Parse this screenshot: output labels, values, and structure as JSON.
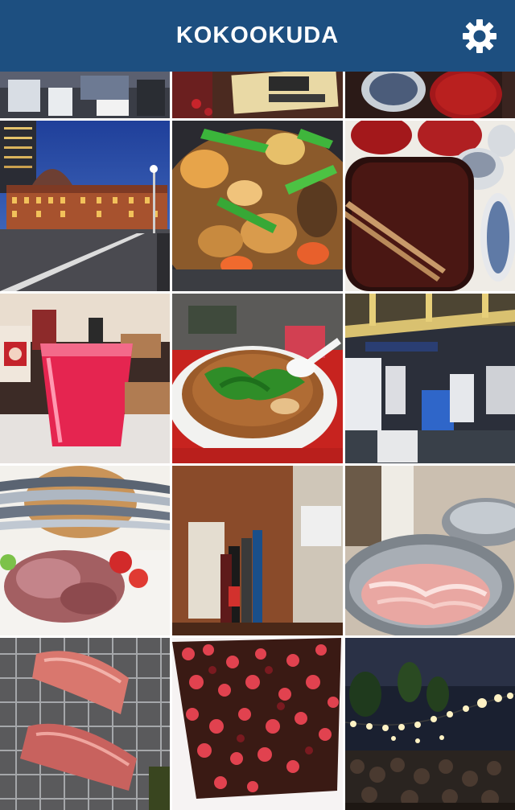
{
  "header": {
    "title": "KOKOOKUDA",
    "background": "#1d4f80",
    "settings_icon": "gear-icon"
  },
  "photos": [
    {
      "subject": "market-stalls"
    },
    {
      "subject": "chicken-sign"
    },
    {
      "subject": "tableware"
    },
    {
      "subject": "tokyo-station-night"
    },
    {
      "subject": "simmered-vegetables"
    },
    {
      "subject": "lacquer-tray-chopsticks"
    },
    {
      "subject": "red-drink"
    },
    {
      "subject": "ramen-bowl"
    },
    {
      "subject": "fish-market-hall"
    },
    {
      "subject": "sanma-fish-and-beef"
    },
    {
      "subject": "wine-bottles"
    },
    {
      "subject": "pork-bowl"
    },
    {
      "subject": "grilled-wagyu"
    },
    {
      "subject": "dish-with-red-balls"
    },
    {
      "subject": "night-festival-lights"
    }
  ]
}
